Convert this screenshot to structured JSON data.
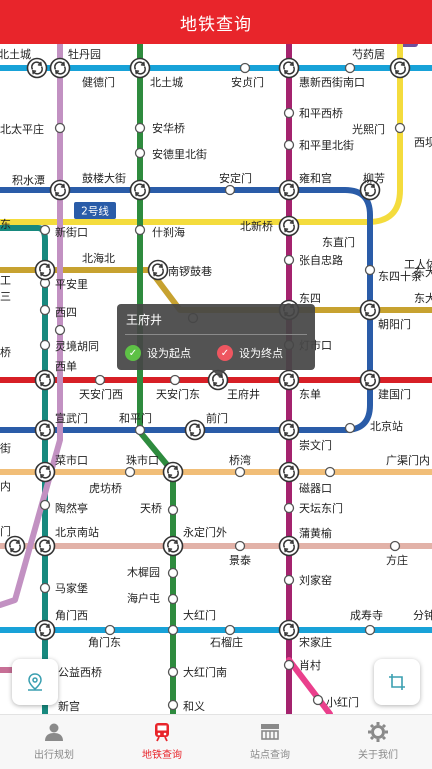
{
  "header": {
    "title": "地铁查询"
  },
  "line_badges": {
    "line2": "2号线"
  },
  "popup": {
    "station": "王府井",
    "set_start": "设为起点",
    "set_end": "设为终点"
  },
  "colors": {
    "accent": "#e8252b",
    "line1": "#d71f26",
    "line2": "#2a5ca8",
    "line4": "#17897e",
    "line5": "#a4236e",
    "line6": "#c7a230",
    "line7": "#eaa17a",
    "line8": "#2e8b3e",
    "line10": "#18a2d8",
    "line13": "#f4dc3d",
    "line14": "#d9ab9a",
    "line15": "#6e4f9c",
    "line20": "#ea3f8c",
    "batong": "#c76f96"
  },
  "stations": [
    {
      "name": "北土城",
      "left": true
    },
    {
      "name": "牡丹园"
    },
    {
      "name": "芍药居"
    },
    {
      "name": "健德门"
    },
    {
      "name": "北土城"
    },
    {
      "name": "安贞门"
    },
    {
      "name": "惠新西街南口"
    },
    {
      "name": "北太平庄"
    },
    {
      "name": "安华桥"
    },
    {
      "name": "和平西桥"
    },
    {
      "name": "光熙门"
    },
    {
      "name": "西坝"
    },
    {
      "name": "安德里北街"
    },
    {
      "name": "和平里北街"
    },
    {
      "name": "积水潭"
    },
    {
      "name": "鼓楼大街"
    },
    {
      "name": "安定门"
    },
    {
      "name": "雍和宫"
    },
    {
      "name": "柳芳"
    },
    {
      "name": "新街口"
    },
    {
      "name": "什刹海"
    },
    {
      "name": "北新桥"
    },
    {
      "name": "东直门"
    },
    {
      "name": "北海北"
    },
    {
      "name": "张自忠路"
    },
    {
      "name": "东四十条"
    },
    {
      "name": "工人体"
    },
    {
      "name": "平安里"
    },
    {
      "name": "南锣鼓巷"
    },
    {
      "name": "东四"
    },
    {
      "name": "东大"
    },
    {
      "name": "西四"
    },
    {
      "name": "朝阳门"
    },
    {
      "name": "灵境胡同"
    },
    {
      "name": "灯市口"
    },
    {
      "name": "西单"
    },
    {
      "name": "天安门西"
    },
    {
      "name": "天安门东"
    },
    {
      "name": "王府井"
    },
    {
      "name": "东单"
    },
    {
      "name": "建国门"
    },
    {
      "name": "宣武门"
    },
    {
      "name": "和平门"
    },
    {
      "name": "前门"
    },
    {
      "name": "北京站"
    },
    {
      "name": "崇文门"
    },
    {
      "name": "菜市口"
    },
    {
      "name": "珠市口"
    },
    {
      "name": "桥湾"
    },
    {
      "name": "广渠门内"
    },
    {
      "name": "虎坊桥"
    },
    {
      "name": "磁器口"
    },
    {
      "name": "陶然亭"
    },
    {
      "name": "天桥"
    },
    {
      "name": "天坛东门"
    },
    {
      "name": "北京南站"
    },
    {
      "name": "永定门外"
    },
    {
      "name": "蒲黄榆"
    },
    {
      "name": "景泰"
    },
    {
      "name": "方庄"
    },
    {
      "name": "马家堡"
    },
    {
      "name": "木樨园"
    },
    {
      "name": "刘家窑"
    },
    {
      "name": "海户屯"
    },
    {
      "name": "角门西"
    },
    {
      "name": "大红门"
    },
    {
      "name": "成寿寺"
    },
    {
      "name": "分钟"
    },
    {
      "name": "角门东"
    },
    {
      "name": "石榴庄"
    },
    {
      "name": "宋家庄"
    },
    {
      "name": "公益西桥"
    },
    {
      "name": "大红门南"
    },
    {
      "name": "肖村"
    },
    {
      "name": "小红门"
    },
    {
      "name": "新宫"
    },
    {
      "name": "和义"
    },
    {
      "name": "东"
    },
    {
      "name": "工"
    },
    {
      "name": "东大桥"
    },
    {
      "name": "内"
    },
    {
      "name": "门"
    },
    {
      "name": "桥"
    },
    {
      "name": "街"
    },
    {
      "name": "三"
    }
  ],
  "nav": [
    {
      "label": "出行规划",
      "icon": "person-icon"
    },
    {
      "label": "地铁查询",
      "icon": "train-icon",
      "active": true
    },
    {
      "label": "站点查询",
      "icon": "station-icon"
    },
    {
      "label": "关于我们",
      "icon": "gear-icon"
    }
  ]
}
